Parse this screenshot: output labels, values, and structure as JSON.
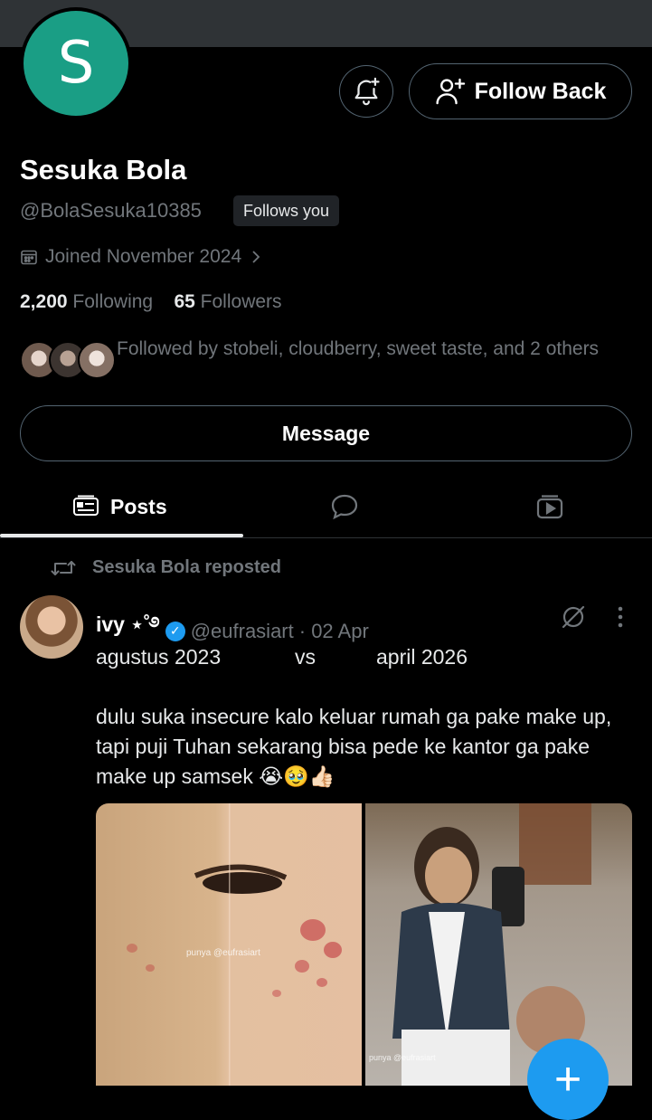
{
  "profile": {
    "avatar_letter": "S",
    "avatar_color": "#1a9e85",
    "name": "Sesuka Bola",
    "handle": "@BolaSesuka10385",
    "follows_you": "Follows you",
    "joined": "Joined November 2024",
    "following_count": "2,200",
    "following_label": "Following",
    "followers_count": "65",
    "followers_label": "Followers",
    "followed_by": "Followed by stobeli, cloudberry, sweet taste, and 2 others"
  },
  "actions": {
    "follow_back": "Follow Back",
    "message": "Message"
  },
  "tabs": {
    "posts": "Posts"
  },
  "post": {
    "repost_label": "Sesuka Bola reposted",
    "author": "ivy ⋆˚࿔",
    "handle": "@eufrasiart",
    "date": "· 02 Apr",
    "line_left": "agustus 2023",
    "line_mid": "vs",
    "line_right": "april 2026",
    "body": "dulu suka insecure kalo keluar rumah ga pake make up, tapi puji Tuhan sekarang bisa pede ke kantor ga pake make up samsek 😭🥹👍🏻",
    "watermark": "punya @eufrasiart"
  },
  "colors": {
    "accent": "#1d9bf0",
    "background": "#000000",
    "muted": "#71767b"
  },
  "icons": {
    "bell": "bell-plus-icon",
    "follow": "person-plus-icon",
    "calendar": "calendar-icon",
    "posts_tab": "posts-icon",
    "replies_tab": "speech-bubble-icon",
    "media_tab": "video-icon",
    "repost": "repost-icon",
    "grok": "grok-icon",
    "more": "more-vertical-icon",
    "compose": "plus-icon"
  }
}
